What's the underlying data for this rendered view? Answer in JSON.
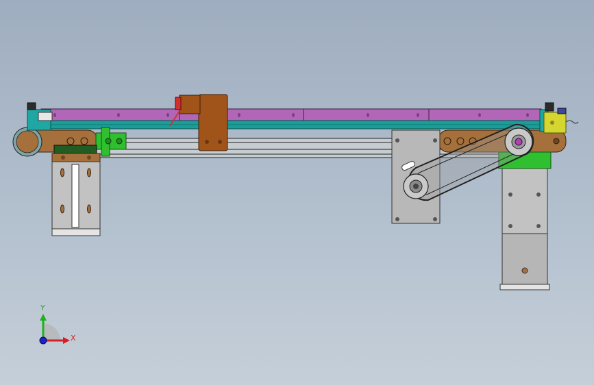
{
  "viewport": {
    "background_top": "#9fadc0",
    "background_bottom": "#c5cfd9"
  },
  "model": {
    "colors": {
      "top_rail": "#b266b8",
      "guide_rail": "#1a9e9a",
      "frame_bar": "#a5703c",
      "carriage": "#a0541a",
      "bracket_green": "#2fbf2f",
      "motor_plate": "#b8b8b8",
      "end_block": "#d6d630",
      "red_clamp": "#d23030",
      "idler_hub": "#b040b0"
    },
    "components": [
      "top-rail",
      "guide-rail",
      "frame-bar",
      "linear-rods",
      "carriage-block",
      "left-motor",
      "right-motor",
      "belt-drive",
      "drive-pulley",
      "idler-pulley",
      "left-end-cap",
      "right-end-cap",
      "sensor-block"
    ]
  },
  "triad": {
    "x_label": "X",
    "y_label": "Y",
    "x_color": "#d42020",
    "y_color": "#20b020",
    "z_color": "#2020c8"
  }
}
